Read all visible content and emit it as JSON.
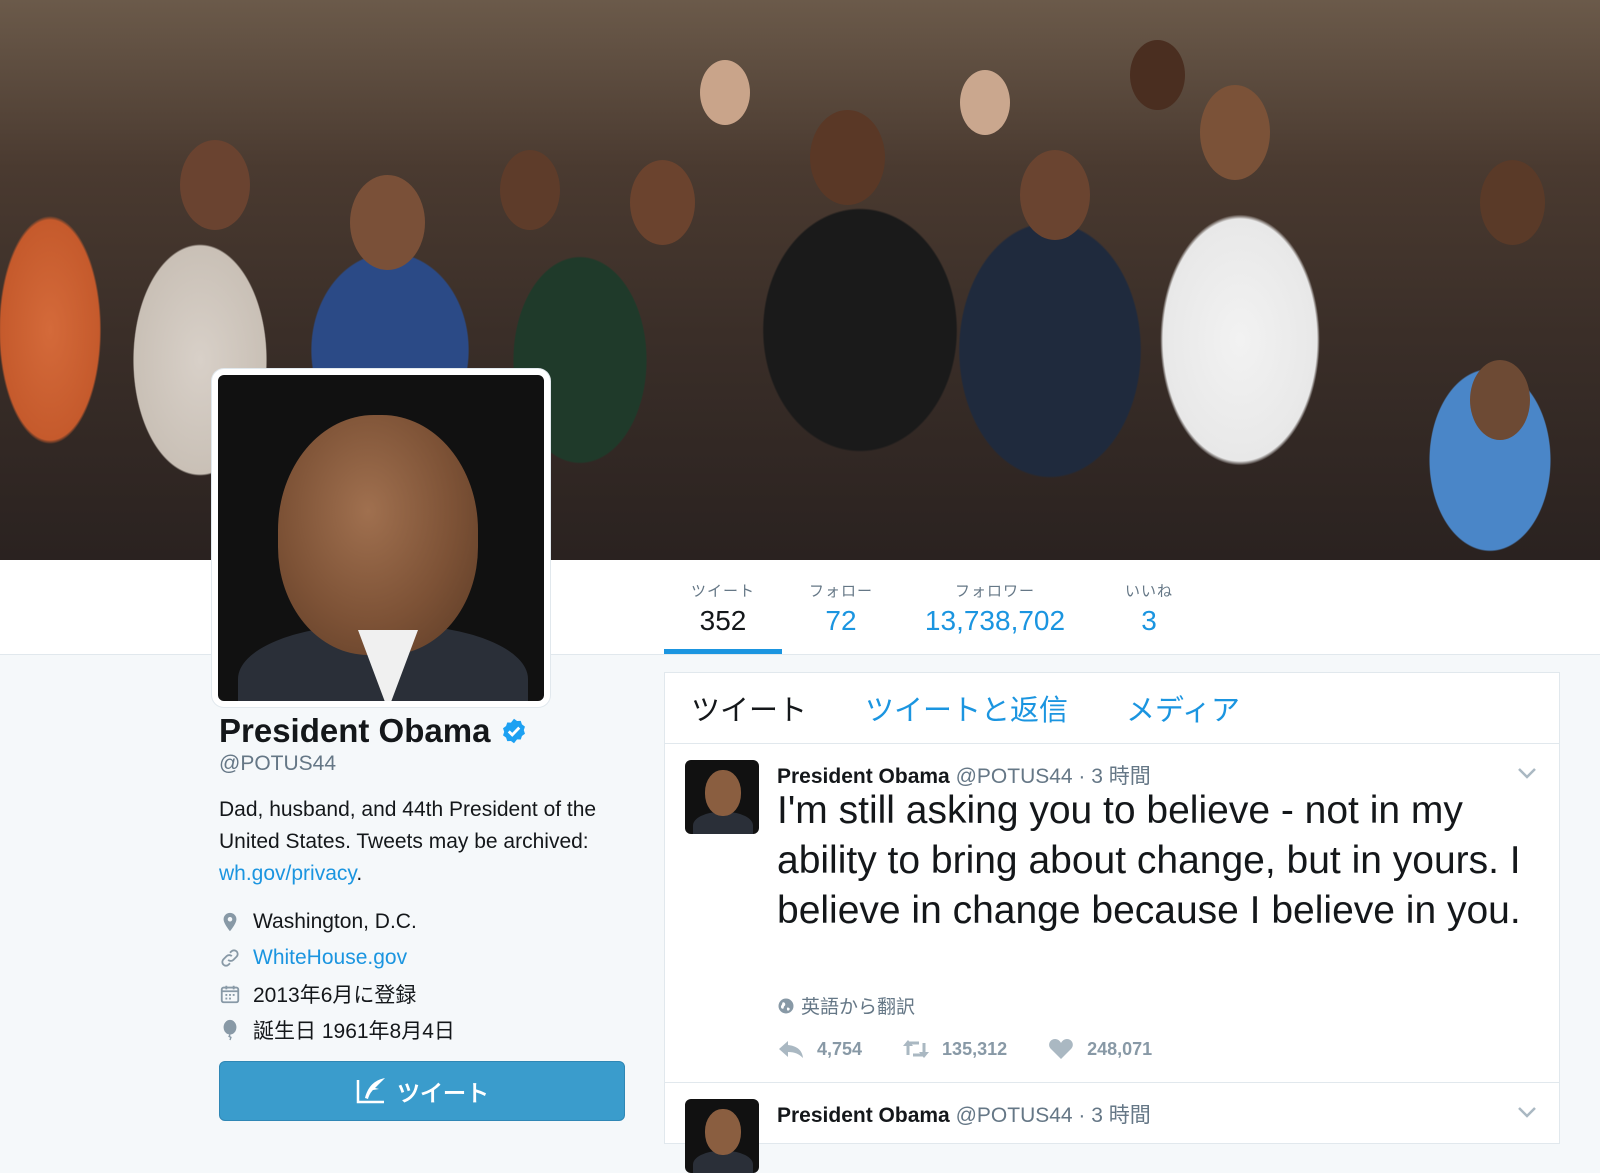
{
  "profile": {
    "name": "President Obama",
    "handle": "@POTUS44",
    "bio_text": "Dad, husband, and 44th President of the United States. Tweets may be archived: ",
    "bio_link": "wh.gov/privacy",
    "bio_end": ".",
    "location": "Washington, D.C.",
    "website": "WhiteHouse.gov",
    "joined": "2013年6月に登録",
    "birthday": "誕生日 1961年8月4日",
    "tweet_button": "ツイート"
  },
  "stats": [
    {
      "label": "ツイート",
      "value": "352"
    },
    {
      "label": "フォロー",
      "value": "72"
    },
    {
      "label": "フォロワー",
      "value": "13,738,702"
    },
    {
      "label": "いいね",
      "value": "3"
    }
  ],
  "tabs": [
    "ツイート",
    "ツイートと返信",
    "メディア"
  ],
  "tweets": [
    {
      "name": "President Obama",
      "handle_time": "@POTUS44 · 3 時間",
      "text": "I'm still asking you to believe - not in my ability to bring about change, but in yours. I believe in change because I believe in you.",
      "translate": "英語から翻訳",
      "replies": "4,754",
      "retweets": "135,312",
      "likes": "248,071"
    },
    {
      "name": "President Obama",
      "handle_time": "@POTUS44 · 3 時間"
    }
  ],
  "colors": {
    "accent": "#1b95e0",
    "tweet_button": "#3a9ccc",
    "verified": "#1da1f2"
  }
}
